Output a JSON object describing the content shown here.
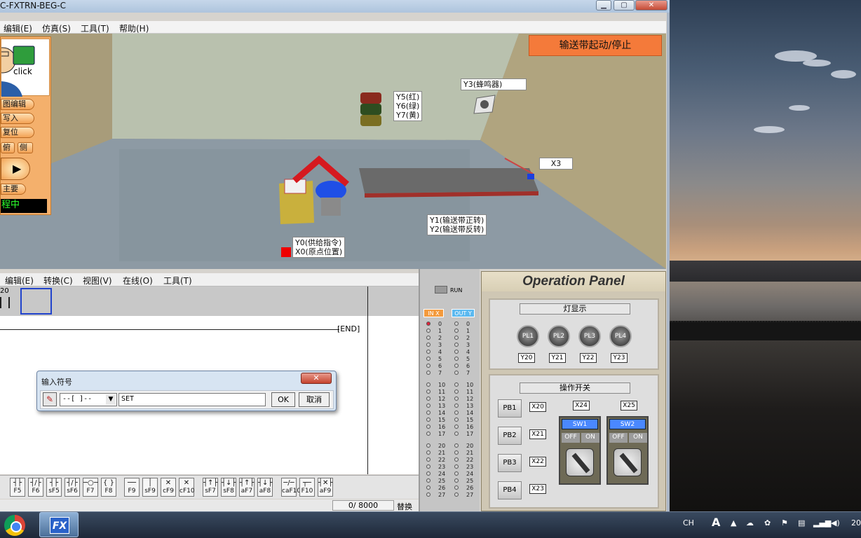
{
  "window": {
    "title": "C-FXTRN-BEG-C",
    "min": "▁",
    "max": "▢",
    "close": "✕"
  },
  "menu": {
    "edit": "编辑(E)",
    "simulate": "仿真(S)",
    "tools": "工具(T)",
    "help": "帮助(H)"
  },
  "control": {
    "click": "click",
    "b1": "图编辑",
    "b2": "写入",
    "b3": "复位",
    "b4a": "俯",
    "b4b": "侧",
    "b6": "主要",
    "status": "程中"
  },
  "conveyor_button": "输送带起动/停止",
  "scene_labels": {
    "y5": "Y5(红)",
    "y6": "Y6(绿)",
    "y7": "Y7(黄)",
    "y3": "Y3(蜂鸣器)",
    "x3": "X3",
    "y1": "Y1(输送带正转)",
    "y2": "Y2(输送带反转)",
    "y0": "Y0(供给指令)",
    "x0": "X0(原点位置)"
  },
  "editor_menu": {
    "edit": "编辑(E)",
    "convert": "转换(C)",
    "view": "视图(V)",
    "online": "在线(O)",
    "tools": "工具(T)"
  },
  "ladder": {
    "step": "20",
    "end": "END"
  },
  "dialog": {
    "title": "输入符号",
    "close": "✕",
    "symbol": "--[  ]--",
    "value": "SET ",
    "ok": "OK",
    "cancel": "取消"
  },
  "fkeys": [
    {
      "sym": "┤├",
      "label": "F5"
    },
    {
      "sym": "┤/├",
      "label": "F6"
    },
    {
      "sym": "┤├",
      "label": "sF5"
    },
    {
      "sym": "┤/├",
      "label": "sF6"
    },
    {
      "sym": "─○─",
      "label": "F7"
    },
    {
      "sym": "{ }",
      "label": "F8"
    },
    {
      "sym": "──",
      "label": "F9"
    },
    {
      "sym": "│",
      "label": "sF9"
    },
    {
      "sym": "✕",
      "label": "cF9"
    },
    {
      "sym": "✕",
      "label": "cF10"
    },
    {
      "sym": "┤↑├",
      "label": "sF7"
    },
    {
      "sym": "┤↓├",
      "label": "sF8"
    },
    {
      "sym": "┤↑├",
      "label": "aF7"
    },
    {
      "sym": "┤↓├",
      "label": "aF8"
    },
    {
      "sym": "─/─",
      "label": "caF10"
    },
    {
      "sym": "┬─",
      "label": "F10"
    },
    {
      "sym": "┤✕├",
      "label": "aF9"
    }
  ],
  "status_bar": {
    "count": "0/ 8000",
    "mode": "替换"
  },
  "io_monitor": {
    "run": "RUN",
    "in_header": "IN X",
    "out_header": "OUT Y",
    "addresses": [
      "0",
      "1",
      "2",
      "3",
      "4",
      "5",
      "6",
      "7",
      "10",
      "11",
      "12",
      "13",
      "14",
      "15",
      "16",
      "17",
      "20",
      "21",
      "22",
      "23",
      "24",
      "25",
      "26",
      "27"
    ]
  },
  "op_panel": {
    "title": "Operation Panel",
    "lamp_header": "灯显示",
    "lamps": [
      {
        "name": "PL1",
        "out": "Y20"
      },
      {
        "name": "PL2",
        "out": "Y21"
      },
      {
        "name": "PL3",
        "out": "Y22"
      },
      {
        "name": "PL4",
        "out": "Y23"
      }
    ],
    "switch_header": "操作开关",
    "buttons": [
      {
        "name": "PB1",
        "in": "X20"
      },
      {
        "name": "PB2",
        "in": "X21"
      },
      {
        "name": "PB3",
        "in": "X22"
      },
      {
        "name": "PB4",
        "in": "X23"
      }
    ],
    "switches": [
      {
        "name": "SW1",
        "in": "X24",
        "off": "OFF",
        "on": "ON"
      },
      {
        "name": "SW2",
        "in": "X25",
        "off": "OFF",
        "on": "ON"
      }
    ]
  },
  "taskbar": {
    "fx": "FX",
    "lang": "CH",
    "font": "A",
    "clock": "20"
  }
}
